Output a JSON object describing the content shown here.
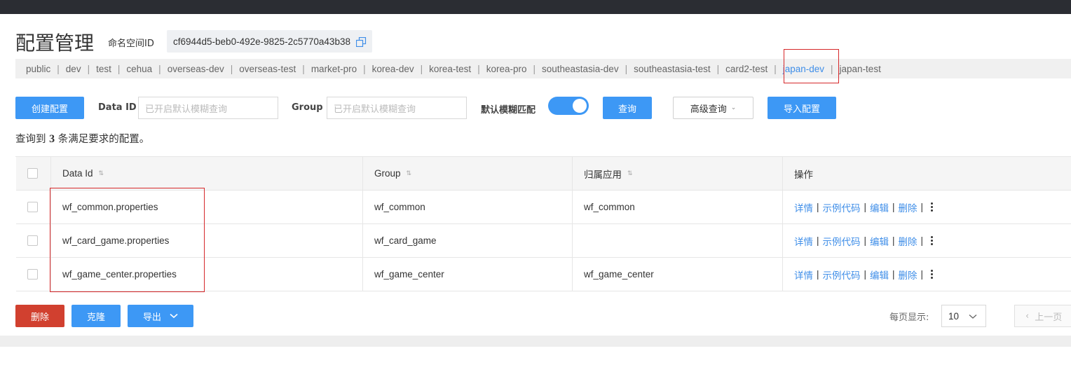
{
  "header": {
    "title": "配置管理",
    "namespace_label": "命名空间ID",
    "namespace_id": "cf6944d5-beb0-492e-9825-2c5770a43b38"
  },
  "namespaces": [
    {
      "label": "public",
      "active": false
    },
    {
      "label": "dev",
      "active": false
    },
    {
      "label": "test",
      "active": false
    },
    {
      "label": "cehua",
      "active": false
    },
    {
      "label": "overseas-dev",
      "active": false
    },
    {
      "label": "overseas-test",
      "active": false
    },
    {
      "label": "market-pro",
      "active": false
    },
    {
      "label": "korea-dev",
      "active": false
    },
    {
      "label": "korea-test",
      "active": false
    },
    {
      "label": "korea-pro",
      "active": false
    },
    {
      "label": "southeastasia-dev",
      "active": false
    },
    {
      "label": "southeastasia-test",
      "active": false
    },
    {
      "label": "card2-test",
      "active": false
    },
    {
      "label": "japan-dev",
      "active": true
    },
    {
      "label": "japan-test",
      "active": false
    }
  ],
  "toolbar": {
    "create_label": "创建配置",
    "data_id_label": "Data ID",
    "data_id_placeholder": "已开启默认模糊查询",
    "group_label": "Group",
    "group_placeholder": "已开启默认模糊查询",
    "fuzzy_label": "默认模糊匹配",
    "fuzzy_enabled": true,
    "query_label": "查询",
    "advanced_label": "高级查询",
    "import_label": "导入配置"
  },
  "result": {
    "prefix": "查询到",
    "count": "3",
    "suffix": "条满足要求的配置。"
  },
  "table": {
    "columns": [
      "Data Id",
      "Group",
      "归属应用",
      "操作"
    ],
    "rows": [
      {
        "data_id": "wf_common.properties",
        "group": "wf_common",
        "app": "wf_common"
      },
      {
        "data_id": "wf_card_game.properties",
        "group": "wf_card_game",
        "app": ""
      },
      {
        "data_id": "wf_game_center.properties",
        "group": "wf_game_center",
        "app": "wf_game_center"
      }
    ],
    "ops": {
      "detail": "详情",
      "sample": "示例代码",
      "edit": "编辑",
      "delete": "删除",
      "sep": "|"
    }
  },
  "footer": {
    "delete_label": "删除",
    "clone_label": "克隆",
    "export_label": "导出",
    "per_page_label": "每页显示:",
    "per_page_value": "10",
    "prev_label": "上一页"
  },
  "colors": {
    "primary": "#3d98f5",
    "danger": "#d1402f",
    "link": "#3f8ee8",
    "highlight": "#d6282a"
  }
}
